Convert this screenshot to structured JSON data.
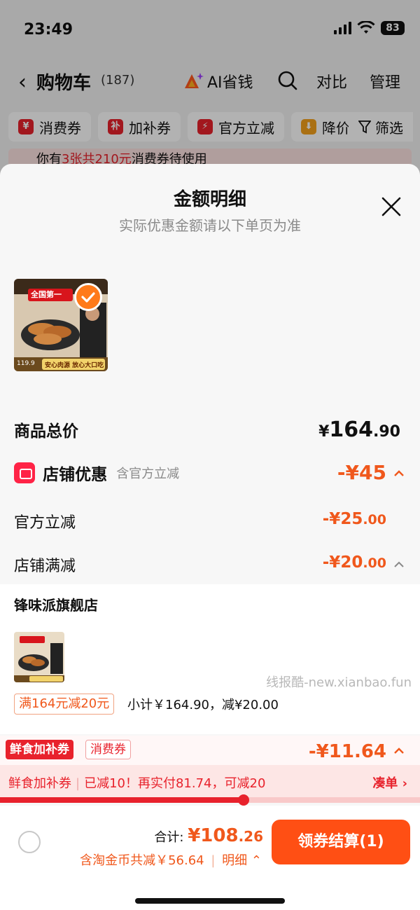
{
  "status": {
    "time": "23:49",
    "battery": "83"
  },
  "nav": {
    "back_icon": "chevron-left-icon",
    "title": "购物车",
    "count": "(187)",
    "ai_label": "AI省钱",
    "compare": "对比",
    "manage": "管理"
  },
  "chips": [
    {
      "icon": "¥",
      "label": "消费券"
    },
    {
      "icon": "补",
      "label": "加补券"
    },
    {
      "icon": "⚡",
      "label": "官方立减"
    },
    {
      "icon": "⬇",
      "label": "降价"
    }
  ],
  "filter_label": "筛选",
  "notice": {
    "prefix": "你有",
    "highlight": "3张共210元",
    "suffix": "消费券待使用"
  },
  "sheet": {
    "title": "金额明细",
    "subtitle": "实际优惠金额请以下单页为准",
    "product_thumb": {
      "headline": "全国第一",
      "price": "119.9",
      "caption": "安心肉源 放心大口吃"
    },
    "total": {
      "label": "商品总价",
      "currency": "¥",
      "int": "164",
      "dec": ".90"
    },
    "store_discount": {
      "label": "店铺优惠",
      "note": "含官方立减",
      "amount": "-¥45"
    },
    "official": {
      "label": "官方立减",
      "amount_int": "-¥25",
      "amount_dec": ".00"
    },
    "threshold": {
      "label": "店铺满减",
      "amount_int": "-¥20",
      "amount_dec": ".00"
    },
    "store": {
      "name": "锋味派旗舰店",
      "watermark": "线报酷-new.xianbao.fun",
      "promo": "满164元减20元",
      "subtotal": "小计￥164.90，减¥20.00"
    },
    "bonus": {
      "tag1": "鲜食加补券",
      "tag2": "消费券",
      "amount": "-¥11.64"
    },
    "topup": {
      "tag": "鲜食加补券",
      "message": "已减10！再实付81.74，可减20",
      "link": "凑单 ›",
      "progress": 0.58
    }
  },
  "footer": {
    "total_label": "合计:",
    "total_int": "¥108",
    "total_dec": ".26",
    "savings": "含淘金币共减￥56.64",
    "detail": "明细",
    "checkout": "领券结算(1)"
  },
  "colors": {
    "accent": "#f0581c",
    "red": "#e8222c",
    "checkout": "#ff4f14"
  }
}
